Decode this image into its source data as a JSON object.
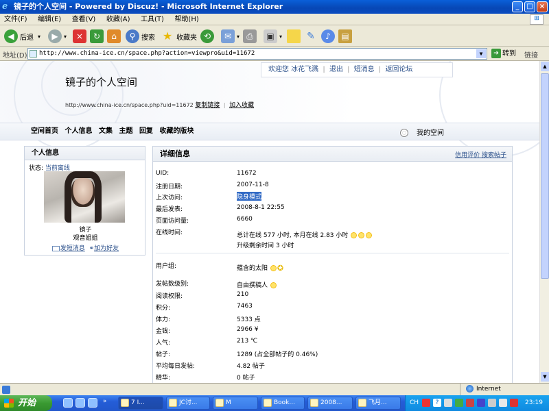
{
  "window": {
    "title": "镜子的个人空间 - Powered by Discuz! - Microsoft Internet Explorer",
    "buttons": {
      "minimize": "_",
      "maximize": "□",
      "close": "×"
    }
  },
  "menu": [
    "文件(F)",
    "编辑(E)",
    "查看(V)",
    "收藏(A)",
    "工具(T)",
    "帮助(H)"
  ],
  "toolbar": {
    "back": "后退",
    "search": "搜索",
    "favorites": "收藏夹",
    "icons": [
      "back-icon",
      "forward-icon",
      "stop-icon",
      "refresh-icon",
      "home-icon",
      "search-icon",
      "favorites-icon",
      "history-icon",
      "mail-icon",
      "print-icon",
      "edit-icon",
      "folder-icon",
      "messenger-icon",
      "media-icon",
      "research-icon"
    ]
  },
  "address": {
    "label": "地址(D)",
    "url": "http://www.china-ice.cn/space.php?action=viewpro&uid=11672",
    "go": "转到",
    "links": "链接"
  },
  "page": {
    "top_nav": {
      "welcome": "欢迎您",
      "username": "冰花飞溅",
      "logout": "退出",
      "messages": "短消息",
      "back_forum": "返回论坛"
    },
    "site_title": "镜子的个人空间",
    "site_url": "http://www.china-ice.cn/space.php?uid=11672",
    "copy_link": "复制链接",
    "add_fav": "加入收藏",
    "nav": [
      "空间首页",
      "个人信息",
      "文集",
      "主题",
      "回复",
      "收藏的版块"
    ],
    "my_space": "我的空间",
    "profile": {
      "header": "个人信息",
      "status_label": "状态:",
      "status_value": "当前离线",
      "name": "镜子",
      "rank": "观音姐姐",
      "send_msg": "发短消息",
      "add_friend": "加为好友"
    },
    "details": {
      "header": "详细信息",
      "credit": "信用评价",
      "search_posts": "搜索帖子",
      "rows": [
        {
          "label": "UID:",
          "value": "11672"
        },
        {
          "label": "注册日期:",
          "value": "2007-11-8"
        },
        {
          "label": "上次访问:",
          "value": "隐身模式"
        },
        {
          "label": "最后发表:",
          "value": "2008-8-1 22:55"
        },
        {
          "label": "页面访问量:",
          "value": "6660"
        },
        {
          "label": "在线时间:",
          "value": "总计在线 577 小时, 本月在线 2.83 小时",
          "value2": "升级剩余时间 3 小时"
        }
      ],
      "rows2": [
        {
          "label": "用户组:",
          "value": "蕴含的太阳"
        },
        {
          "label": "发帖数级别:",
          "value": "自由撰稿人"
        },
        {
          "label": "阅读权限:",
          "value": "210"
        },
        {
          "label": "积分:",
          "value": "7463"
        },
        {
          "label": "体力:",
          "value": "5333 点"
        },
        {
          "label": "金钱:",
          "value": "2966 ¥"
        },
        {
          "label": "人气:",
          "value": "213 ℃"
        },
        {
          "label": "帖子:",
          "value": "1289 (占全部帖子的 0.46%)"
        },
        {
          "label": "平均每日发帖:",
          "value": "4.82 帖子"
        },
        {
          "label": "精华:",
          "value": "0 帖子"
        }
      ]
    }
  },
  "status": {
    "zone": "Internet"
  },
  "taskbar": {
    "start": "开始",
    "tasks": [
      "7 I...",
      "JC讨...",
      "M",
      "Book...",
      "2008...",
      "飞月..."
    ],
    "lang": "CH",
    "clock": "23:19"
  }
}
